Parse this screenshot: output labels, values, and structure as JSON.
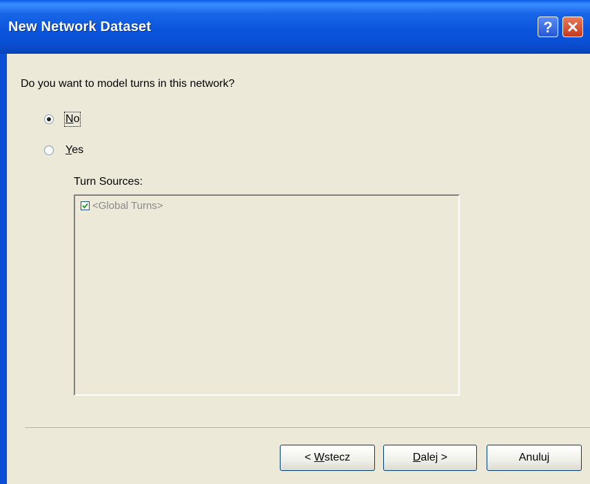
{
  "window": {
    "title": "New Network Dataset",
    "help_label": "?",
    "close_label": "✕"
  },
  "question": "Do you want to model turns in this network?",
  "options": [
    {
      "mnemonic": "N",
      "rest": "o",
      "selected": true
    },
    {
      "mnemonic": "Y",
      "rest": "es",
      "selected": false
    }
  ],
  "turn_sources": {
    "label": "Turn Sources:",
    "items": [
      {
        "label": "<Global Turns>",
        "checked": true
      }
    ]
  },
  "buttons": {
    "back": {
      "prefix": "< ",
      "mnemonic": "W",
      "rest": "stecz"
    },
    "next": {
      "mnemonic": "D",
      "rest": "alej >"
    },
    "cancel": {
      "label": "Anuluj"
    }
  }
}
